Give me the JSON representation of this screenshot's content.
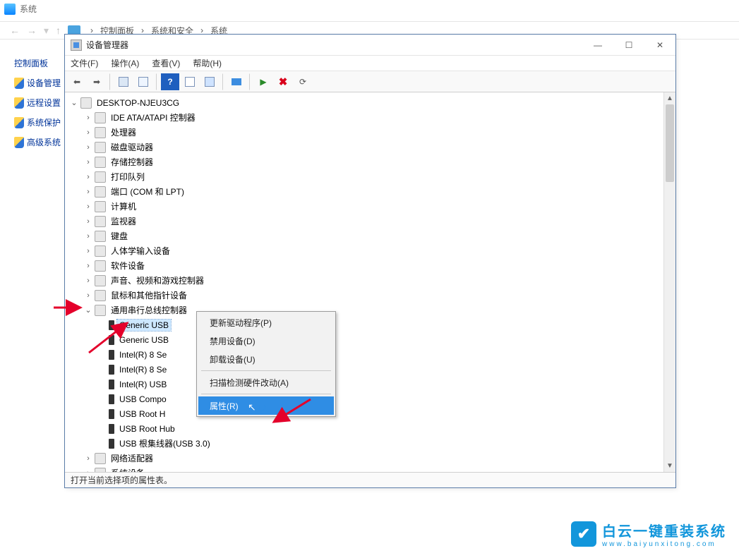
{
  "bg": {
    "title": "系统",
    "crumbs": [
      "控制面板",
      "系统和安全",
      "系统"
    ],
    "sidebar_header": "控制面板",
    "sidebar_links": [
      "设备管理",
      "远程设置",
      "系统保护",
      "高级系统"
    ]
  },
  "dm": {
    "title": "设备管理器",
    "menu": {
      "file": "文件(F)",
      "action": "操作(A)",
      "view": "查看(V)",
      "help": "帮助(H)"
    },
    "status": "打开当前选择项的属性表。",
    "root": "DESKTOP-NJEU3CG",
    "categories": [
      {
        "label": "IDE ATA/ATAPI 控制器",
        "exp": false
      },
      {
        "label": "处理器",
        "exp": false
      },
      {
        "label": "磁盘驱动器",
        "exp": false
      },
      {
        "label": "存储控制器",
        "exp": false
      },
      {
        "label": "打印队列",
        "exp": false
      },
      {
        "label": "端口 (COM 和 LPT)",
        "exp": false
      },
      {
        "label": "计算机",
        "exp": false
      },
      {
        "label": "监视器",
        "exp": false
      },
      {
        "label": "键盘",
        "exp": false
      },
      {
        "label": "人体学输入设备",
        "exp": false
      },
      {
        "label": "软件设备",
        "exp": false
      },
      {
        "label": "声音、视频和游戏控制器",
        "exp": false
      },
      {
        "label": "鼠标和其他指针设备",
        "exp": false
      },
      {
        "label": "通用串行总线控制器",
        "exp": true,
        "children": [
          {
            "label": "Generic USB",
            "sel": true
          },
          {
            "label": "Generic USB"
          },
          {
            "label": "Intel(R) 8 Se"
          },
          {
            "label": "Intel(R) 8 Se"
          },
          {
            "label": "Intel(R) USB"
          },
          {
            "label": "USB Compo"
          },
          {
            "label": "USB Root H"
          },
          {
            "label": "USB Root Hub"
          },
          {
            "label": "USB 根集线器(USB 3.0)"
          }
        ]
      },
      {
        "label": "网络适配器",
        "exp": false
      },
      {
        "label": "系统设备",
        "exp": false
      }
    ]
  },
  "ctx": {
    "items": [
      {
        "label": "更新驱动程序(P)",
        "hover": false
      },
      {
        "label": "禁用设备(D)",
        "hover": false
      },
      {
        "label": "卸载设备(U)",
        "hover": false
      },
      {
        "sep": true
      },
      {
        "label": "扫描检测硬件改动(A)",
        "hover": false
      },
      {
        "sep": true
      },
      {
        "label": "属性(R)",
        "hover": true
      }
    ]
  },
  "watermark": {
    "zh": "白云一键重装系统",
    "en": "www.baiyunxitong.com"
  }
}
